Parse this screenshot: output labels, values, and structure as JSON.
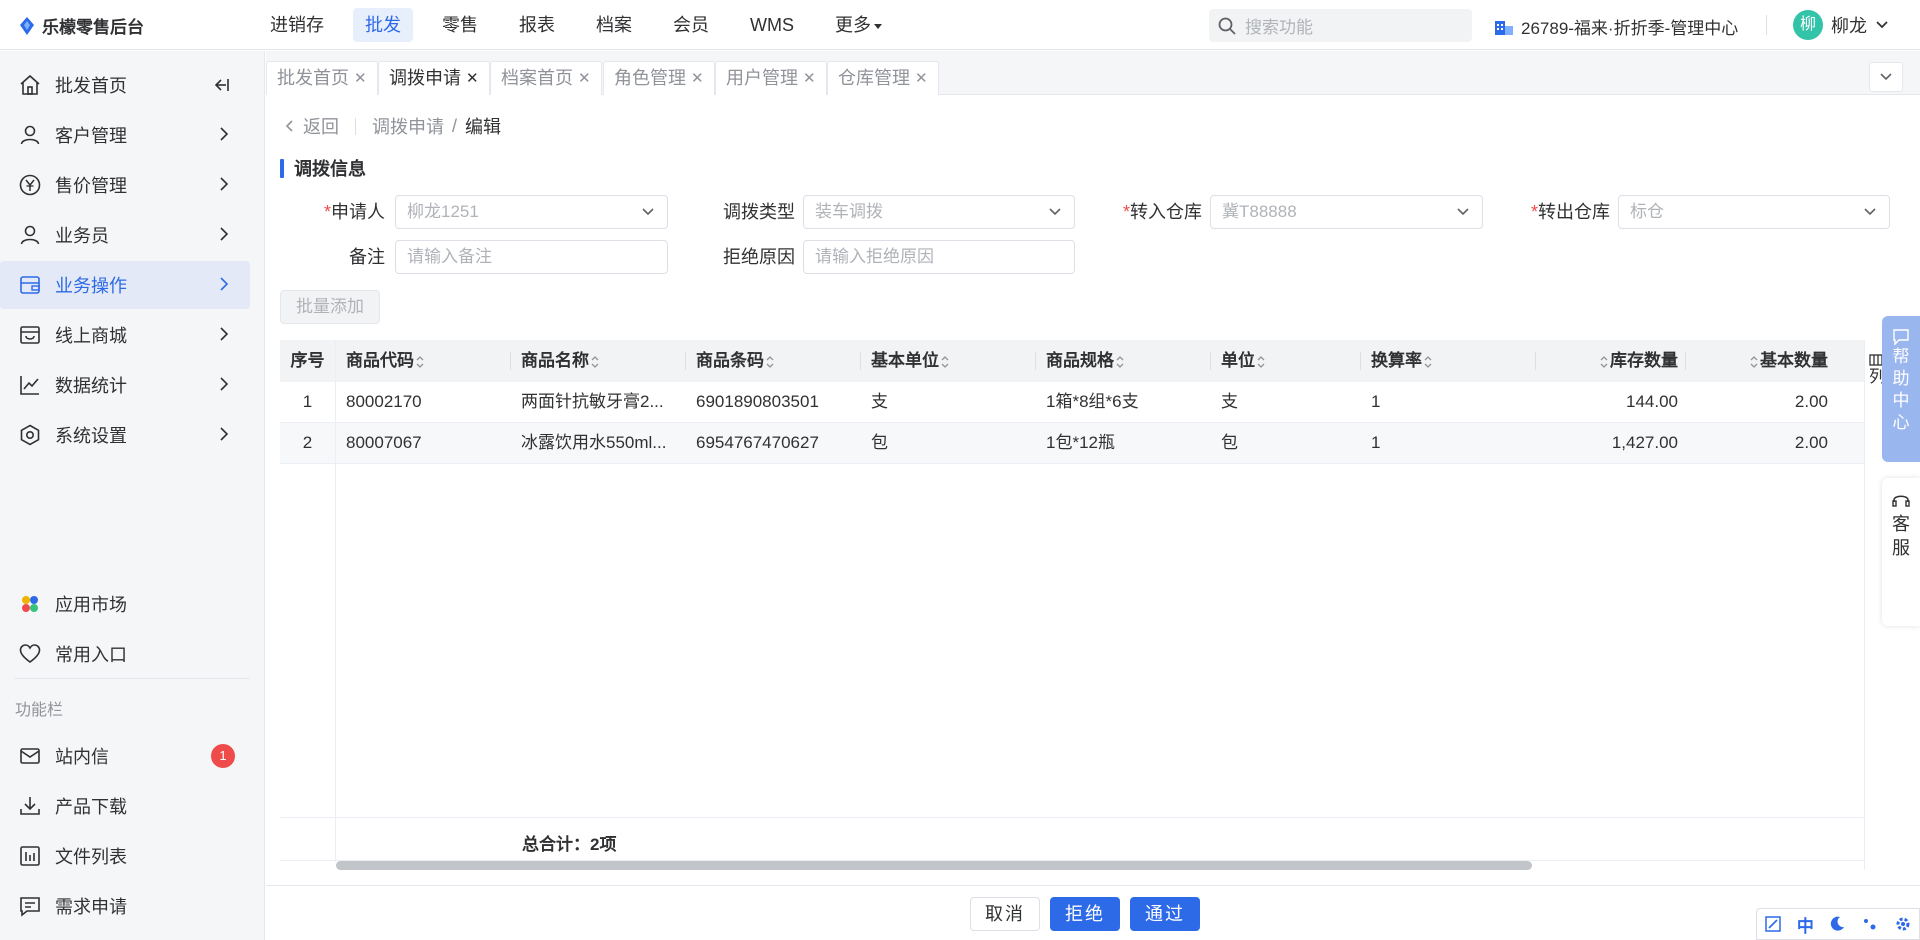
{
  "app": {
    "title": "乐檬零售后台"
  },
  "topnav": {
    "items": [
      "进销存",
      "批发",
      "零售",
      "报表",
      "档案",
      "会员",
      "WMS",
      "更多"
    ],
    "active_index": 1
  },
  "search": {
    "placeholder": "搜索功能"
  },
  "store": {
    "name": "26789-福来·折折季-管理中心"
  },
  "user": {
    "avatar_char": "柳",
    "name": "柳龙"
  },
  "sidebar": {
    "items": [
      {
        "label": "批发首页",
        "icon": "home-icon"
      },
      {
        "label": "客户管理",
        "icon": "user-icon"
      },
      {
        "label": "售价管理",
        "icon": "yen-icon"
      },
      {
        "label": "业务员",
        "icon": "user-icon"
      },
      {
        "label": "业务操作",
        "icon": "wallet-icon"
      },
      {
        "label": "线上商城",
        "icon": "shop-icon"
      },
      {
        "label": "数据统计",
        "icon": "chart-icon"
      },
      {
        "label": "系统设置",
        "icon": "settings-icon"
      }
    ],
    "active_index": 4,
    "bottom_items": [
      {
        "label": "应用市场",
        "icon": "apps-icon"
      },
      {
        "label": "常用入口",
        "icon": "heart-icon"
      }
    ],
    "group_label": "功能栏",
    "func_items": [
      {
        "label": "站内信",
        "icon": "mail-icon",
        "badge": "1"
      },
      {
        "label": "产品下载",
        "icon": "download-icon"
      },
      {
        "label": "文件列表",
        "icon": "file-list-icon"
      },
      {
        "label": "需求申请",
        "icon": "message-icon"
      }
    ]
  },
  "tabs": {
    "items": [
      "批发首页",
      "调拨申请",
      "档案首页",
      "角色管理",
      "用户管理",
      "仓库管理"
    ],
    "active_index": 1
  },
  "breadcrumb": {
    "back": "返回",
    "parent": "调拨申请",
    "separator": "/",
    "current": "编辑"
  },
  "section": {
    "title": "调拨信息"
  },
  "form": {
    "applicant": {
      "label": "申请人",
      "value": "柳龙1251"
    },
    "transfer_type": {
      "label": "调拨类型",
      "value": "装车调拨"
    },
    "in_warehouse": {
      "label": "转入仓库",
      "value": "冀T88888"
    },
    "out_warehouse": {
      "label": "转出仓库",
      "value": "标仓"
    },
    "remark": {
      "label": "备注",
      "placeholder": "请输入备注"
    },
    "reject_reason": {
      "label": "拒绝原因",
      "placeholder": "请输入拒绝原因"
    },
    "required_mark": "*"
  },
  "batch_add": {
    "label": "批量添加"
  },
  "table": {
    "columns": [
      "序号",
      "商品代码",
      "商品名称",
      "商品条码",
      "基本单位",
      "商品规格",
      "单位",
      "换算率",
      "库存数量",
      "基本数量"
    ],
    "rows": [
      [
        "1",
        "80002170",
        "两面针抗敏牙膏2...",
        "6901890803501",
        "支",
        "1箱*8组*6支",
        "支",
        "1",
        "144.00",
        "2.00"
      ],
      [
        "2",
        "80007067",
        "冰露饮用水550ml...",
        "6954767470627",
        "包",
        "1包*12瓶",
        "包",
        "1",
        "1,427.00",
        "2.00"
      ]
    ],
    "column_settings_label": "列",
    "footer_total": "总合计：2项"
  },
  "actions": {
    "cancel": "取消",
    "reject": "拒绝",
    "approve": "通过"
  },
  "float": {
    "help": [
      "帮",
      "助",
      "中",
      "心"
    ],
    "service": [
      "客",
      "服"
    ],
    "tools_lang": "中"
  },
  "colors": {
    "accent": "#2d6ae8",
    "danger": "#f04b4b",
    "active_bg": "#e3e9f6"
  }
}
